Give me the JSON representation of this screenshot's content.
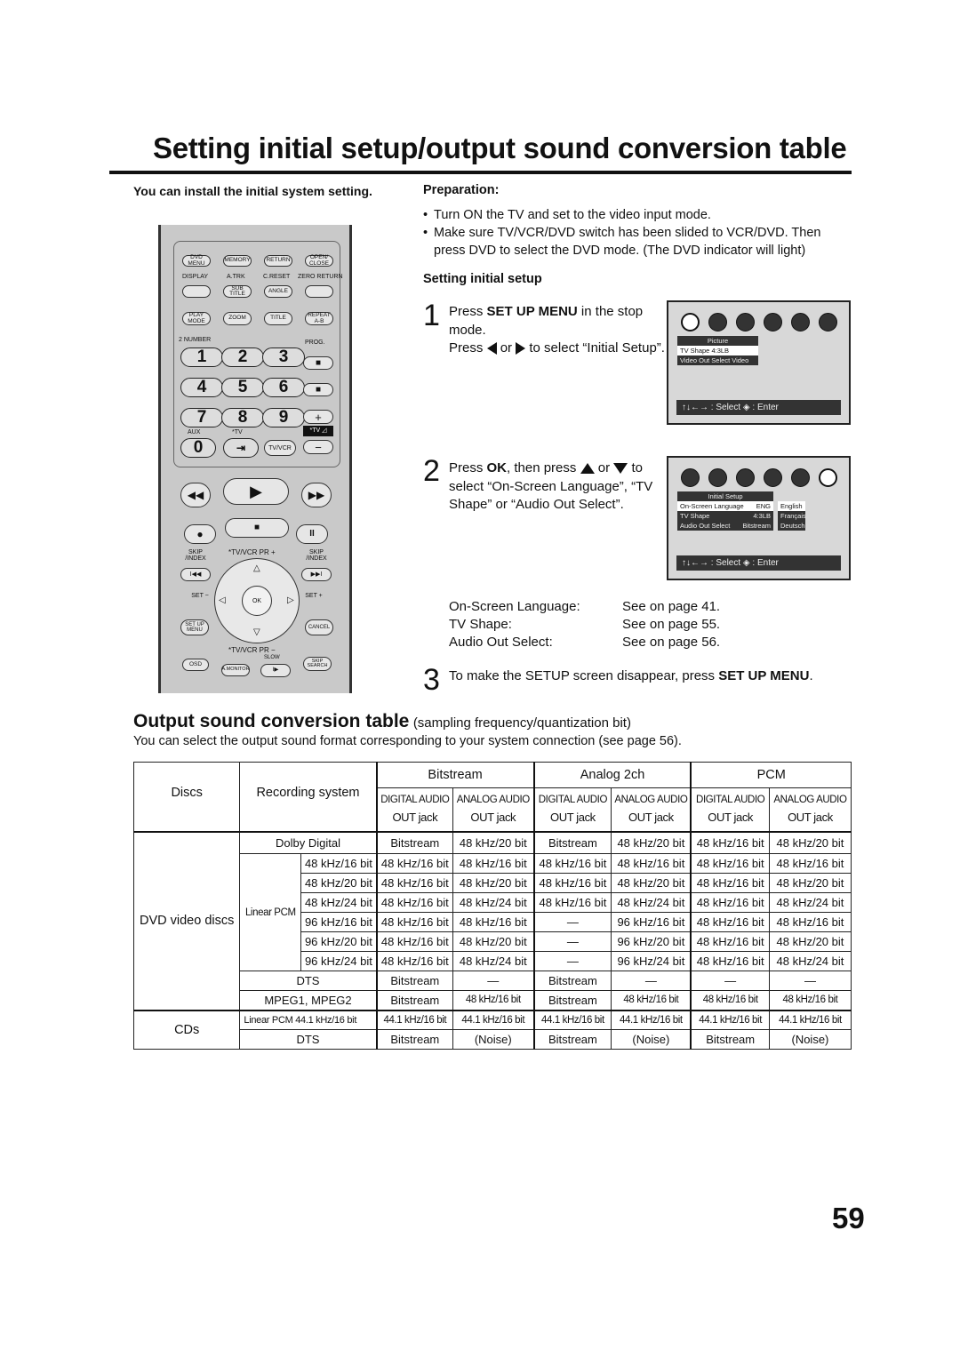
{
  "page": {
    "title": "Setting initial setup/output sound conversion table",
    "page_number": "59"
  },
  "intro": {
    "text": "You can install the initial system setting."
  },
  "preparation": {
    "heading": "Preparation:",
    "bullets": [
      "Turn ON the TV and set to the video input mode.",
      "Make sure TV/VCR/DVD switch has been slided to VCR/DVD. Then press DVD to select the DVD mode. (The DVD indicator will light)"
    ]
  },
  "setup": {
    "heading": "Setting initial setup",
    "steps": [
      {
        "num": "1",
        "line1_pre": "Press ",
        "line1_bold": "SET UP MENU",
        "line1_post": " in the stop mode.",
        "line2_pre": "Press",
        "line2_mid": "or",
        "line2_post": "to select “Initial Setup”."
      },
      {
        "num": "2",
        "pre": "Press ",
        "bold": "OK",
        "mid": ", then press",
        "or": "or",
        "post": "to select “On-Screen Language”, “TV Shape” or “Audio Out Select”."
      },
      {
        "num": "3",
        "pre": "To make the SETUP screen disappear, press ",
        "bold": "SET UP MENU",
        "post": "."
      }
    ],
    "references": [
      {
        "label": "On-Screen Language:",
        "value": "See on page 41."
      },
      {
        "label": "TV Shape:",
        "value": "See on page 55."
      },
      {
        "label": "Audio Out Select:",
        "value": "See on page 56."
      }
    ]
  },
  "osd1": {
    "panel_title": "Picture",
    "rows": [
      "TV Shape 4:3LB",
      "Video Out Select Video"
    ],
    "hint_arrows": "↑↓←→",
    "hint_select": ": Select",
    "hint_enter": ": Enter"
  },
  "osd2": {
    "panel_title": "Initial Setup",
    "rows": [
      {
        "label": "On-Screen Language",
        "value": "ENG"
      },
      {
        "label": "TV Shape",
        "value": "4:3LB"
      },
      {
        "label": "Audio Out Select",
        "value": "Bitstream"
      }
    ],
    "languages": [
      "English",
      "Français",
      "Deutsch"
    ],
    "hint_arrows": "↑↓←→",
    "hint_select": ": Select",
    "hint_enter": ": Enter"
  },
  "remote": {
    "row1": [
      "DVD MENU",
      "MEMORY",
      "RETURN",
      "OPEN/ CLOSE"
    ],
    "row2_labels": [
      "DISPLAY",
      "A.TRK",
      "C.RESET",
      "ZERO RETURN"
    ],
    "row2": [
      "",
      "SUB TITLE",
      "ANGLE",
      ""
    ],
    "row3": [
      "PLAY MODE",
      "ZOOM",
      "TITLE",
      "REPEAT A-B"
    ],
    "number_label": "2 NUMBER",
    "prog_label": "PROG.",
    "digits": [
      "1",
      "2",
      "3",
      "4",
      "5",
      "6",
      "7",
      "8",
      "9",
      "0"
    ],
    "aux_label": "AUX",
    "tv_label": "*TV",
    "tvvcr": "TV/VCR",
    "tv_vol": "*TV ◿",
    "skip_index": "SKIP /INDEX",
    "tvvcr_pr_plus": "*TV/VCR PR +",
    "tvvcr_pr_minus": "*TV/VCR PR −",
    "set_minus": "SET −",
    "set_plus": "SET +",
    "ok": "OK",
    "setup_menu": "SET UP MENU",
    "cancel": "CANCEL",
    "osd": "OSD",
    "amonitor": "A.MONITOR",
    "slow": "SLOW",
    "skip_search": "SKIP SEARCH"
  },
  "conversion": {
    "heading_bold": "Output sound conversion table",
    "heading_note": "(sampling frequency/quantization bit)",
    "description": "You can select the output sound format corresponding to your system connection (see page 56).",
    "col_discs": "Discs",
    "col_recording": "Recording system",
    "groups": [
      "Bitstream",
      "Analog 2ch",
      "PCM"
    ],
    "sub_top": "DIGITAL AUDIO",
    "sub_top_analog": "ANALOG AUDIO",
    "sub_bottom": "OUT jack",
    "dvd_label": "DVD video discs",
    "cd_label": "CDs",
    "linear_pcm": "Linear PCM",
    "rows": [
      {
        "system": "Dolby Digital",
        "values": [
          "Bitstream",
          "48 kHz/20 bit",
          "Bitstream",
          "48 kHz/20 bit",
          "48 kHz/16 bit",
          "48 kHz/20 bit"
        ]
      },
      {
        "system": "48 kHz/16 bit",
        "values": [
          "48 kHz/16 bit",
          "48 kHz/16 bit",
          "48 kHz/16 bit",
          "48 kHz/16 bit",
          "48 kHz/16 bit",
          "48 kHz/16 bit"
        ]
      },
      {
        "system": "48 kHz/20 bit",
        "values": [
          "48 kHz/16 bit",
          "48 kHz/20 bit",
          "48 kHz/16 bit",
          "48 kHz/20 bit",
          "48 kHz/16 bit",
          "48 kHz/20 bit"
        ]
      },
      {
        "system": "48 kHz/24 bit",
        "values": [
          "48 kHz/16 bit",
          "48 kHz/24 bit",
          "48 kHz/16 bit",
          "48 kHz/24 bit",
          "48 kHz/16 bit",
          "48 kHz/24 bit"
        ]
      },
      {
        "system": "96 kHz/16 bit",
        "values": [
          "48 kHz/16 bit",
          "48 kHz/16 bit",
          "—",
          "96 kHz/16 bit",
          "48 kHz/16 bit",
          "48 kHz/16 bit"
        ]
      },
      {
        "system": "96 kHz/20 bit",
        "values": [
          "48 kHz/16 bit",
          "48 kHz/20 bit",
          "—",
          "96 kHz/20 bit",
          "48 kHz/16 bit",
          "48 kHz/20 bit"
        ]
      },
      {
        "system": "96 kHz/24 bit",
        "values": [
          "48 kHz/16 bit",
          "48 kHz/24 bit",
          "—",
          "96 kHz/24 bit",
          "48 kHz/16 bit",
          "48 kHz/24 bit"
        ]
      },
      {
        "system": "DTS",
        "values": [
          "Bitstream",
          "—",
          "Bitstream",
          "—",
          "—",
          "—"
        ]
      },
      {
        "system": "MPEG1, MPEG2",
        "values": [
          "Bitstream",
          "48 kHz/16 bit",
          "Bitstream",
          "48 kHz/16 bit",
          "48 kHz/16 bit",
          "48 kHz/16 bit"
        ]
      },
      {
        "system": "Linear PCM 44.1 kHz/16 bit",
        "values": [
          "44.1 kHz/16 bit",
          "44.1 kHz/16 bit",
          "44.1 kHz/16 bit",
          "44.1 kHz/16 bit",
          "44.1 kHz/16 bit",
          "44.1 kHz/16 bit"
        ]
      },
      {
        "system": "DTS",
        "values": [
          "Bitstream",
          "(Noise)",
          "Bitstream",
          "(Noise)",
          "Bitstream",
          "(Noise)"
        ]
      }
    ]
  }
}
